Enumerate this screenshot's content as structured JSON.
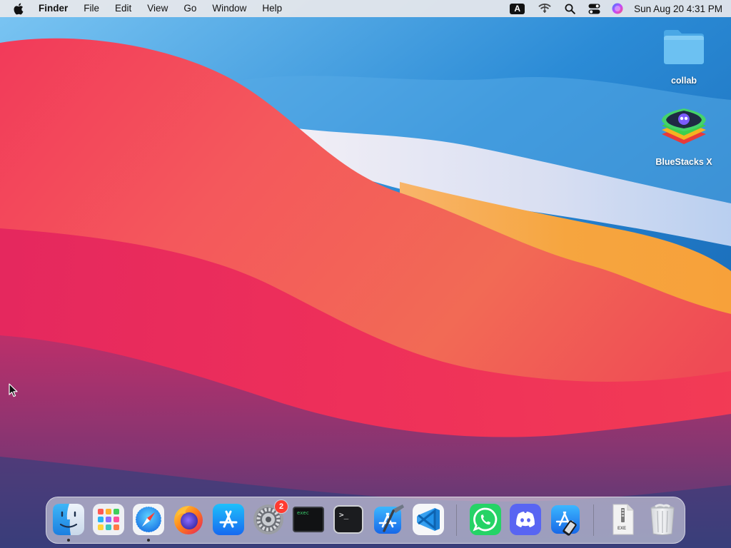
{
  "menubar": {
    "apple_icon": "apple-logo-icon",
    "app_name": "Finder",
    "menus": [
      "File",
      "Edit",
      "View",
      "Go",
      "Window",
      "Help"
    ],
    "input_source": "A",
    "status_icons": [
      "input-source-icon",
      "wifi-icon",
      "spotlight-search-icon",
      "control-center-icon",
      "siri-icon"
    ],
    "clock": "Sun Aug 20  4:31 PM"
  },
  "desktop": {
    "icons": [
      {
        "label": "collab",
        "icon": "folder-icon"
      },
      {
        "label": "BlueStacks X",
        "icon": "bluestacks-x-icon"
      }
    ]
  },
  "dock": {
    "apps": [
      {
        "name": "Finder",
        "icon": "finder-icon",
        "running": true
      },
      {
        "name": "Launchpad",
        "icon": "launchpad-icon",
        "running": false
      },
      {
        "name": "Safari",
        "icon": "safari-icon",
        "running": true
      },
      {
        "name": "Firefox",
        "icon": "firefox-icon",
        "running": false
      },
      {
        "name": "App Store",
        "icon": "app-store-icon",
        "running": false
      },
      {
        "name": "System Preferences",
        "icon": "system-preferences-icon",
        "running": false,
        "badge": "2"
      },
      {
        "name": "Console",
        "icon": "console-icon",
        "running": false,
        "screen_text": "exec"
      },
      {
        "name": "Terminal",
        "icon": "terminal-icon",
        "running": false,
        "screen_text": ">_"
      },
      {
        "name": "Xcode",
        "icon": "xcode-icon",
        "running": false
      },
      {
        "name": "Visual Studio Code",
        "icon": "vscode-icon",
        "running": false
      },
      {
        "name": "WhatsApp",
        "icon": "whatsapp-icon",
        "running": false
      },
      {
        "name": "Discord",
        "icon": "discord-icon",
        "running": false
      },
      {
        "name": "Simulator",
        "icon": "simulator-icon",
        "running": false
      },
      {
        "name": "Document",
        "icon": "document-icon",
        "running": false,
        "file_text": "EXE"
      },
      {
        "name": "Trash",
        "icon": "trash-icon",
        "running": false
      }
    ]
  }
}
